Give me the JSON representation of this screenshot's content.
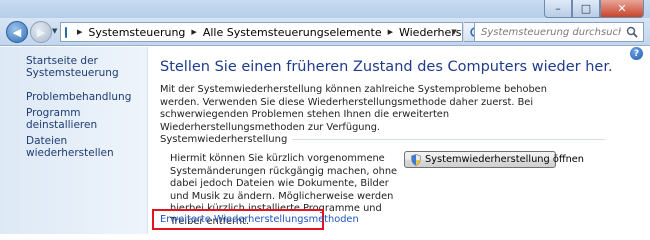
{
  "addressbar": {
    "breadcrumbs": [
      "Systemsteuerung",
      "Alle Systemsteuerungselemente",
      "Wiederherstellung"
    ],
    "search_placeholder": "Systemsteuerung durchsuchen"
  },
  "sidebar": {
    "home_label": "Startseite der Systemsteuerung",
    "tasks": [
      "Problembehandlung",
      "Programm deinstallieren",
      "Dateien wiederherstellen"
    ]
  },
  "main": {
    "title": "Stellen Sie einen früheren Zustand des Computers wieder her.",
    "intro": "Mit der Systemwiederherstellung können zahlreiche Systemprobleme behoben werden. Verwenden Sie diese Wiederherstellungsmethode daher zuerst. Bei schwerwiegenden Problemen stehen Ihnen die erweiterten Wiederherstellungsmethoden zur Verfügung.",
    "group_title": "Systemwiederherstellung",
    "group_desc": "Hiermit können Sie kürzlich vorgenommene Systemänderungen rückgängig machen, ohne dabei jedoch Dateien wie Dokumente, Bilder und Musik zu ändern. Möglicherweise werden hierbei kürzlich installierte Programme und Treiber entfernt.",
    "restore_button": "Systemwiederherstellung öffnen",
    "advanced_link": "Erweiterte Wiederherstellungsmethoden"
  },
  "icons": {
    "back": "back-arrow-icon",
    "forward": "forward-arrow-icon",
    "control_panel": "control-panel-icon",
    "refresh": "refresh-icon",
    "search": "search-icon",
    "help": "help-icon",
    "shield": "uac-shield-icon"
  },
  "colors": {
    "link": "#1e55c0",
    "title": "#1e3b8c",
    "highlight_box": "#e3141f"
  }
}
